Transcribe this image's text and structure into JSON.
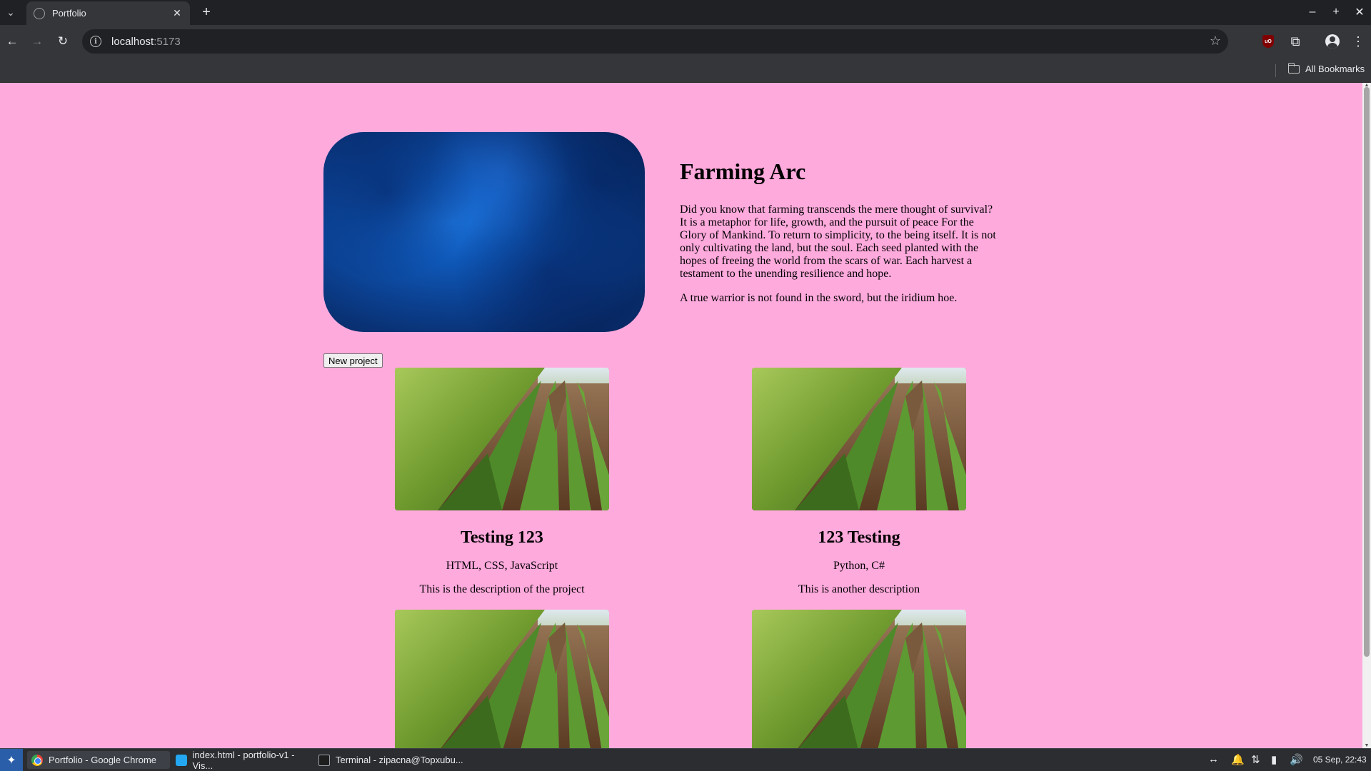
{
  "browser": {
    "tab": {
      "title": "Portfolio"
    },
    "address": {
      "host": "localhost",
      "port": ":5173"
    },
    "bookmarks": {
      "all_label": "All Bookmarks"
    },
    "ublock_badge": "uO"
  },
  "page": {
    "hero": {
      "title": "Farming Arc",
      "paragraph": "Did you know that farming transcends the mere thought of survival? It is a metaphor for life, growth, and the pursuit of peace For the Glory of Mankind. To return to simplicity, to the being itself. It is not only cultivating the land, but the soul. Each seed planted with the hopes of freeing the world from the scars of war. Each harvest a testament to the unending resilience and hope.",
      "quote": "A true warrior is not found in the sword, but the iridium hoe."
    },
    "new_project_label": "New project",
    "projects": [
      {
        "title": "Testing 123",
        "tech": "HTML, CSS, JavaScript",
        "description": "This is the description of the project"
      },
      {
        "title": "123 Testing",
        "tech": "Python, C#",
        "description": "This is another description"
      },
      {
        "title": "",
        "tech": "",
        "description": ""
      },
      {
        "title": "",
        "tech": "",
        "description": ""
      }
    ]
  },
  "taskbar": {
    "tasks": [
      {
        "label": "Portfolio - Google Chrome",
        "icon": "chrome-icon"
      },
      {
        "label": "index.html - portfolio-v1 - Vis...",
        "icon": "vscode-icon"
      },
      {
        "label": "Terminal - zipacna@Topxubu...",
        "icon": "terminal-icon"
      }
    ],
    "clock": "05 Sep, 22:43"
  },
  "colors": {
    "page_bg": "#ffaadd",
    "hero_blue": "#0b4fb0"
  }
}
